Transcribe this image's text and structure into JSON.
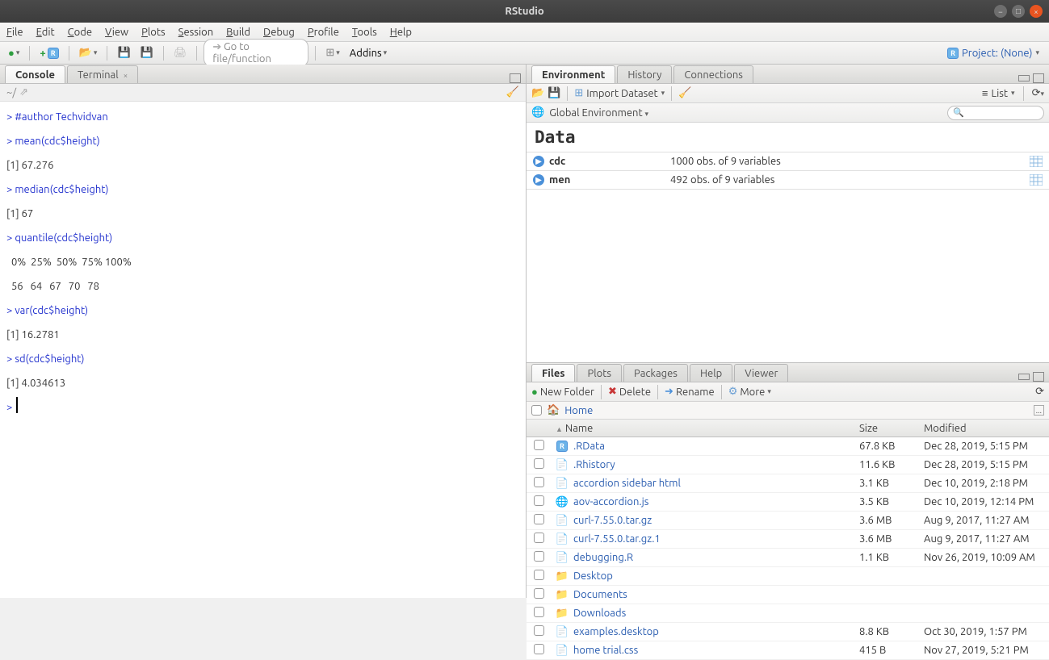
{
  "window": {
    "title": "RStudio"
  },
  "menubar": [
    "File",
    "Edit",
    "Code",
    "View",
    "Plots",
    "Session",
    "Build",
    "Debug",
    "Profile",
    "Tools",
    "Help"
  ],
  "toolbar": {
    "goto_placeholder": "Go to file/function",
    "addins_label": "Addins",
    "project_label": "Project: (None)"
  },
  "console": {
    "tab_console": "Console",
    "tab_terminal": "Terminal",
    "path": "~/",
    "lines": [
      {
        "type": "cmd",
        "text": "#author Techvidvan"
      },
      {
        "type": "cmd",
        "text": "mean(cdc$height)"
      },
      {
        "type": "out",
        "text": "[1] 67.276"
      },
      {
        "type": "cmd",
        "text": "median(cdc$height)"
      },
      {
        "type": "out",
        "text": "[1] 67"
      },
      {
        "type": "cmd",
        "text": "quantile(cdc$height)"
      },
      {
        "type": "out",
        "text": "  0%  25%  50%  75% 100% "
      },
      {
        "type": "out",
        "text": "  56   64   67   70   78 "
      },
      {
        "type": "cmd",
        "text": "var(cdc$height)"
      },
      {
        "type": "out",
        "text": "[1] 16.2781"
      },
      {
        "type": "cmd",
        "text": "sd(cdc$height)"
      },
      {
        "type": "out",
        "text": "[1] 4.034613"
      },
      {
        "type": "prompt",
        "text": ""
      }
    ]
  },
  "env": {
    "tabs": [
      "Environment",
      "History",
      "Connections"
    ],
    "import_label": "Import Dataset",
    "global_label": "Global Environment",
    "list_label": "List",
    "section": "Data",
    "rows": [
      {
        "name": "cdc",
        "value": "1000 obs. of 9 variables"
      },
      {
        "name": "men",
        "value": "492 obs. of 9 variables"
      }
    ]
  },
  "files": {
    "tabs": [
      "Files",
      "Plots",
      "Packages",
      "Help",
      "Viewer"
    ],
    "new_folder": "New Folder",
    "delete": "Delete",
    "rename": "Rename",
    "more": "More",
    "home": "Home",
    "headers": {
      "name": "Name",
      "size": "Size",
      "modified": "Modified"
    },
    "rows": [
      {
        "icon": "rdata",
        "name": ".RData",
        "size": "67.8 KB",
        "modified": "Dec 28, 2019, 5:15 PM"
      },
      {
        "icon": "file",
        "name": ".Rhistory",
        "size": "11.6 KB",
        "modified": "Dec 28, 2019, 5:15 PM"
      },
      {
        "icon": "file",
        "name": "accordion sidebar html",
        "size": "3.1 KB",
        "modified": "Dec 10, 2019, 2:18 PM"
      },
      {
        "icon": "js",
        "name": "aov-accordion.js",
        "size": "3.5 KB",
        "modified": "Dec 10, 2019, 12:14 PM"
      },
      {
        "icon": "file",
        "name": "curl-7.55.0.tar.gz",
        "size": "3.6 MB",
        "modified": "Aug 9, 2017, 11:27 AM"
      },
      {
        "icon": "file",
        "name": "curl-7.55.0.tar.gz.1",
        "size": "3.6 MB",
        "modified": "Aug 9, 2017, 11:27 AM"
      },
      {
        "icon": "file",
        "name": "debugging.R",
        "size": "1.1 KB",
        "modified": "Nov 26, 2019, 10:09 AM"
      },
      {
        "icon": "folder",
        "name": "Desktop",
        "size": "",
        "modified": ""
      },
      {
        "icon": "folder",
        "name": "Documents",
        "size": "",
        "modified": ""
      },
      {
        "icon": "folder",
        "name": "Downloads",
        "size": "",
        "modified": ""
      },
      {
        "icon": "file",
        "name": "examples.desktop",
        "size": "8.8 KB",
        "modified": "Oct 30, 2019, 1:57 PM"
      },
      {
        "icon": "file",
        "name": "home trial.css",
        "size": "415 B",
        "modified": "Nov 27, 2019, 5:21 PM"
      }
    ]
  }
}
